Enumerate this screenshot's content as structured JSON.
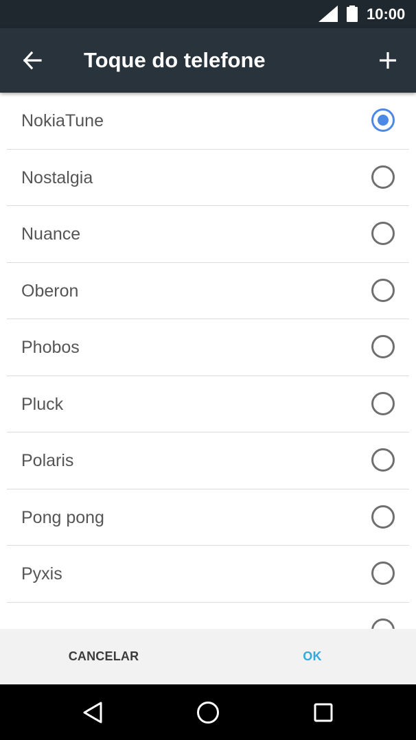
{
  "status_bar": {
    "time": "10:00"
  },
  "app_bar": {
    "title": "Toque do telefone",
    "back_icon": "arrow-left-icon",
    "add_icon": "plus-icon"
  },
  "ringtones": [
    {
      "name": "NokiaTune",
      "selected": true
    },
    {
      "name": "Nostalgia",
      "selected": false
    },
    {
      "name": "Nuance",
      "selected": false
    },
    {
      "name": "Oberon",
      "selected": false
    },
    {
      "name": "Phobos",
      "selected": false
    },
    {
      "name": "Pluck",
      "selected": false
    },
    {
      "name": "Polaris",
      "selected": false
    },
    {
      "name": "Pong pong",
      "selected": false
    },
    {
      "name": "Pyxis",
      "selected": false
    },
    {
      "name": "",
      "selected": false
    }
  ],
  "actions": {
    "cancel_label": "CANCELAR",
    "ok_label": "OK"
  },
  "colors": {
    "accent": "#4c88e6",
    "ok_text": "#35a9dc",
    "app_bar": "#28333b",
    "status_bar": "#1f282e"
  }
}
